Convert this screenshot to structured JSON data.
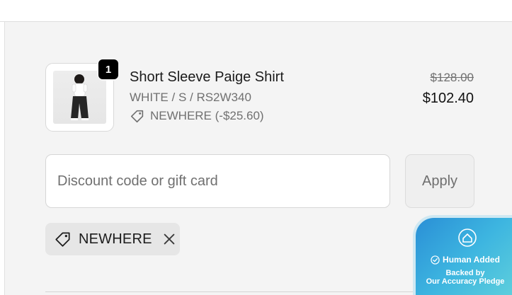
{
  "cart_item": {
    "quantity": "1",
    "title": "Short Sleeve Paige Shirt",
    "variant": "WHITE / S / RS2W340",
    "discount_line": "NEWHERE (-$25.60)",
    "original_price": "$128.00",
    "final_price": "$102.40",
    "image_icon": "product-photo"
  },
  "discount_form": {
    "placeholder": "Discount code or gift card",
    "value": "",
    "apply_label": "Apply"
  },
  "applied_code": {
    "code": "NEWHERE",
    "tag_icon": "tag-icon",
    "remove_icon": "close-icon"
  },
  "accuracy_badge": {
    "headline": "Human Added",
    "line1": "Backed by",
    "line2": "Our Accuracy Pledge",
    "icon": "shield-icon",
    "check_icon": "check-circle-icon"
  },
  "colors": {
    "panel_bg": "#f4f4f4",
    "badge_gradient_start": "#2a8fd6",
    "badge_gradient_end": "#5fd0dc",
    "muted_text": "#707070"
  }
}
